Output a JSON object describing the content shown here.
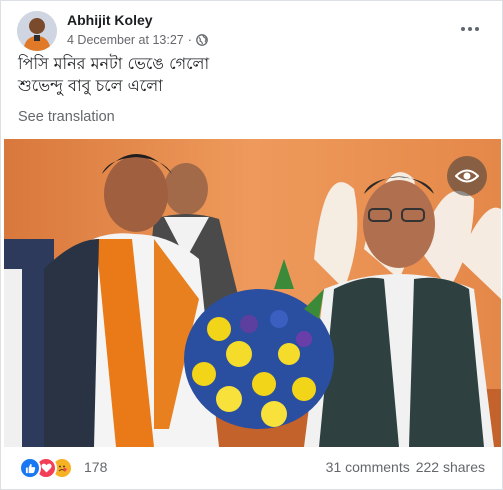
{
  "post": {
    "author": "Abhijit Koley",
    "date": "4 December at 13:27",
    "meta_separator": "·",
    "text_lines": [
      "পিসি মনির মনটা ভেঙে গেলো",
      "শুভেন্দু বাবু চলে এলো"
    ],
    "see_translation": "See translation"
  },
  "icons": {
    "audience": "globe-icon",
    "options": "more-options-icon",
    "photo_overlay": "eye-icon",
    "reactions": [
      "like-icon",
      "love-icon",
      "care-icon"
    ]
  },
  "footer": {
    "reaction_count": "178",
    "comments": "31 comments",
    "shares": "222 shares"
  },
  "colors": {
    "like": "#1877f2",
    "love": "#f33e58",
    "care": "#f7b125",
    "text": "#1c1e21",
    "secondary": "#65676b"
  }
}
